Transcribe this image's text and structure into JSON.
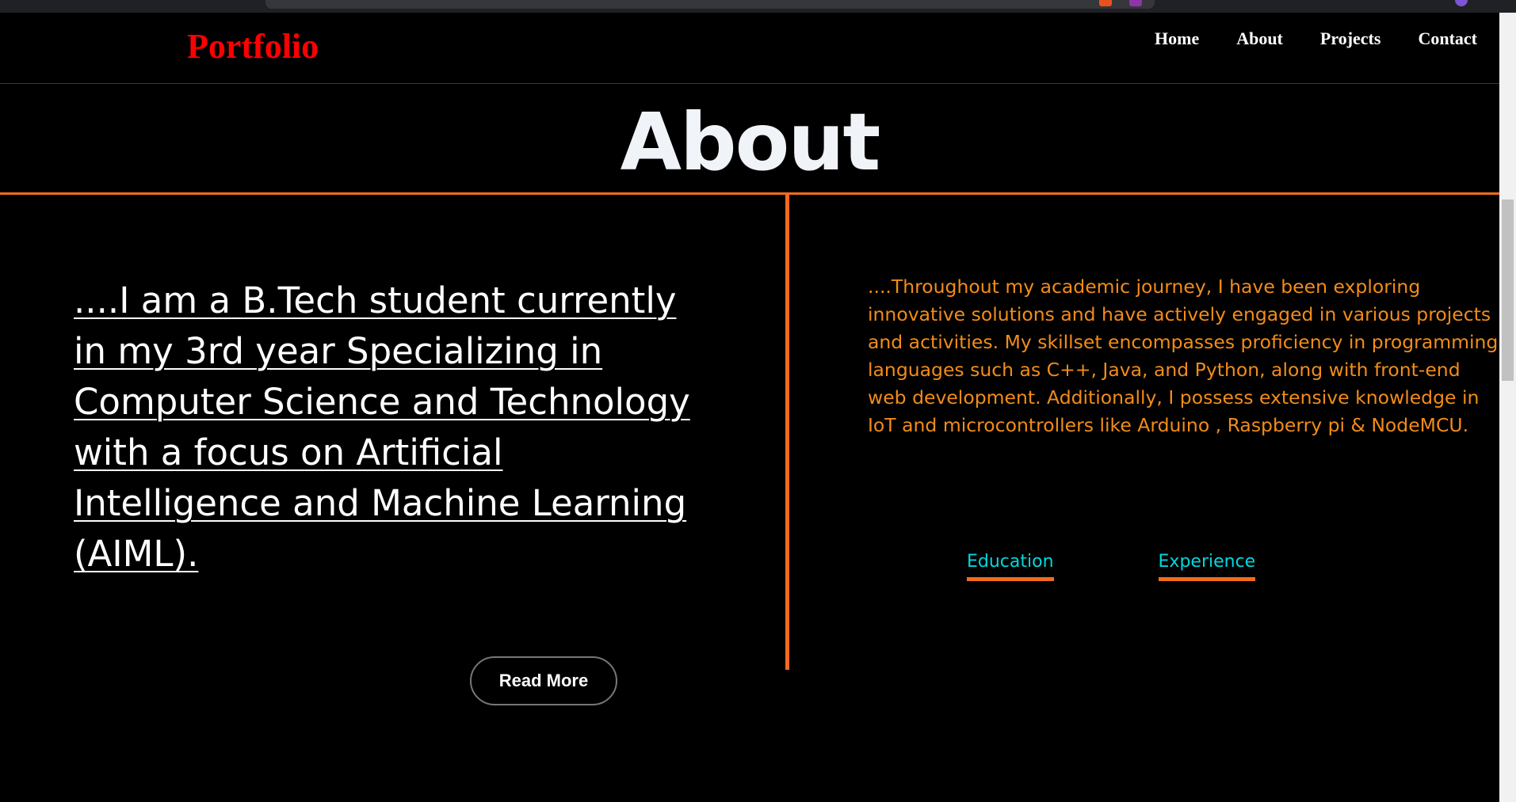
{
  "navbar": {
    "logo": "Portfolio",
    "links": [
      "Home",
      "About",
      "Projects",
      "Contact"
    ]
  },
  "about": {
    "title": "About",
    "intro": "....I am a B.Tech student currently in my 3rd year Specializing in Computer Science and Technology with a focus on Artificial Intelligence and Machine Learning (AIML).",
    "read_more_label": "Read More",
    "details": "....Throughout my academic journey, I have been exploring innovative solutions and have actively engaged in various projects and activities. My skillset encompasses proficiency in programming languages such as C++, Java, and Python, along with front-end web development. Additionally, I possess extensive knowledge in IoT and microcontrollers like Arduino , Raspberry pi & NodeMCU.",
    "tabs": [
      "Education",
      "Experience"
    ]
  },
  "colors": {
    "accent": "#f26b1d",
    "logo": "#ff0000",
    "details_text": "#f28c1a",
    "tab_text": "#00d8de",
    "background": "#000000"
  }
}
